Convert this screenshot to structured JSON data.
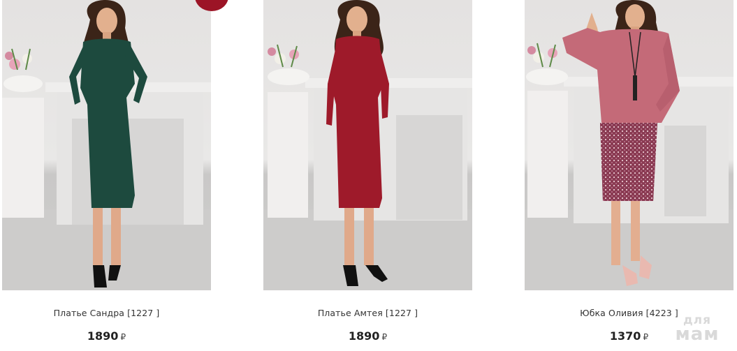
{
  "products": [
    {
      "name": "Платье Сандра [1227 ]",
      "price": "1890",
      "currency": "₽",
      "dress_color": "#1d4a3e",
      "has_sale_badge": true
    },
    {
      "name": "Платье Амтея [1227 ]",
      "price": "1890",
      "currency": "₽",
      "dress_color": "#9e1a2a",
      "has_sale_badge": false
    },
    {
      "name": "Юбка Оливия [4223 ]",
      "price": "1370",
      "currency": "₽",
      "dress_color": "#c46a78",
      "has_sale_badge": false
    }
  ],
  "watermark": {
    "line1": "для",
    "line2": "мам"
  },
  "colors": {
    "sale_badge": "#9c1426",
    "price_text": "#222222",
    "name_text": "#333333"
  }
}
